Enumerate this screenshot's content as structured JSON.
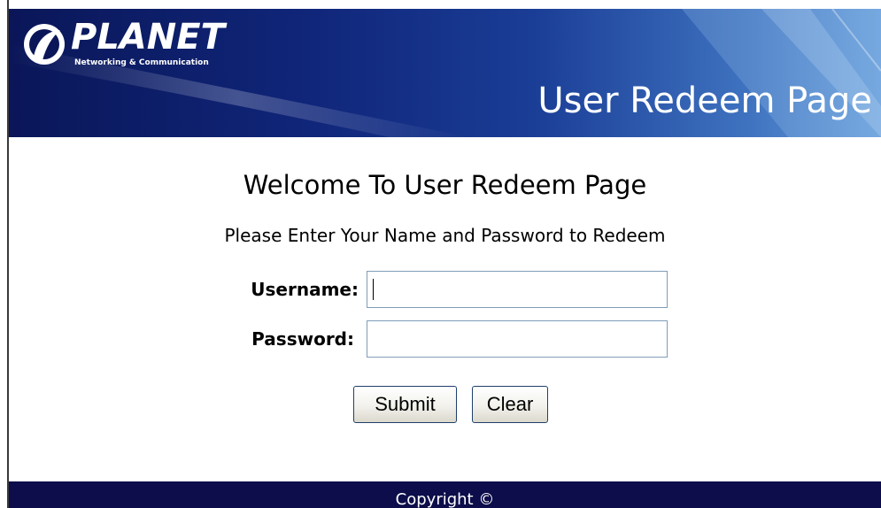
{
  "header": {
    "logo_text": "PLANET",
    "logo_subtitle": "Networking & Communication",
    "page_title": "User Redeem Page"
  },
  "main": {
    "welcome": "Welcome To User Redeem Page",
    "instructions": "Please Enter Your Name and Password to Redeem",
    "username_label": "Username:",
    "username_value": "",
    "password_label": "Password:",
    "password_value": "",
    "submit_label": "Submit",
    "clear_label": "Clear"
  },
  "footer": {
    "copyright": "Copyright ©"
  },
  "colors": {
    "banner_dark": "#0a1658",
    "banner_light": "#6aa0dc",
    "footer_bg": "#0c0d4a",
    "input_border": "#7f9db9"
  },
  "icons": {
    "logo": "planet-logo-icon"
  }
}
